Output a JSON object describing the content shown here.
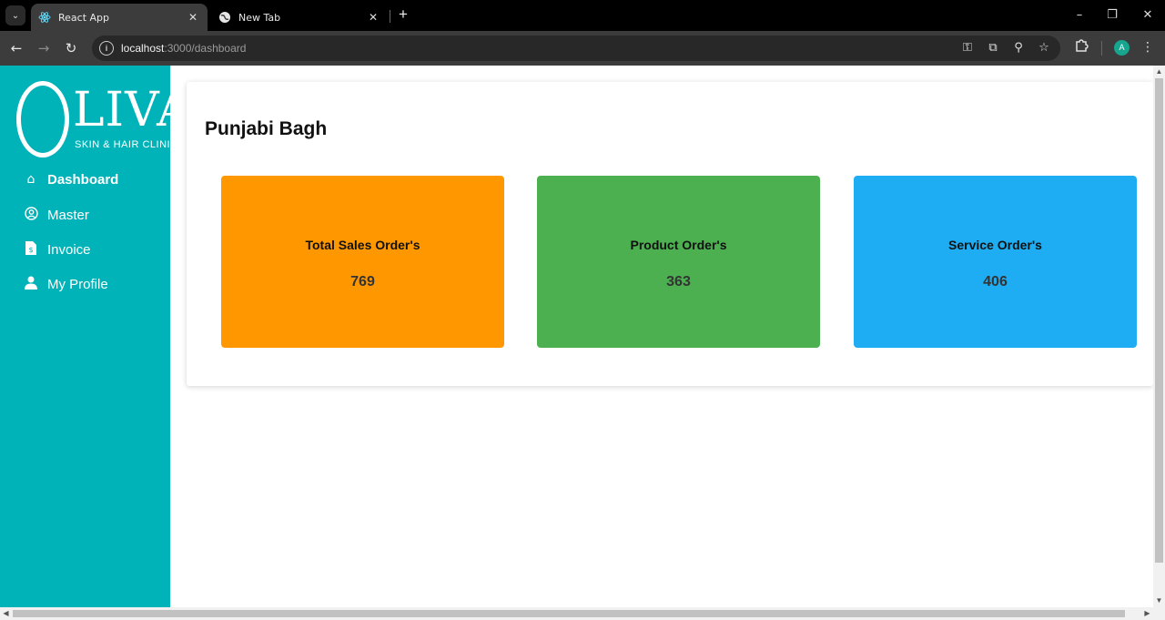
{
  "browser": {
    "tabs": [
      {
        "title": "React App",
        "icon": "react-icon"
      },
      {
        "title": "New Tab",
        "icon": "globe-icon"
      }
    ],
    "url_host": "localhost",
    "url_path": ":3000/dashboard"
  },
  "profile_initial": "A",
  "sidebar": {
    "logo_text": "LIVA",
    "logo_subtitle": "SKIN & HAIR CLINIC",
    "items": [
      {
        "label": "Dashboard",
        "icon": "home-icon"
      },
      {
        "label": "Master",
        "icon": "user-circle-icon"
      },
      {
        "label": "Invoice",
        "icon": "invoice-icon"
      },
      {
        "label": "My Profile",
        "icon": "person-icon"
      }
    ]
  },
  "dashboard": {
    "branch": "Punjabi Bagh",
    "cards": [
      {
        "label": "Total Sales Order's",
        "value": "769",
        "color": "#ff9800"
      },
      {
        "label": "Product Order's",
        "value": "363",
        "color": "#4caf50"
      },
      {
        "label": "Service Order's",
        "value": "406",
        "color": "#1eadf3"
      }
    ]
  },
  "colors": {
    "sidebar": "#00b3b9",
    "chrome_dark": "#3c3c3c"
  }
}
